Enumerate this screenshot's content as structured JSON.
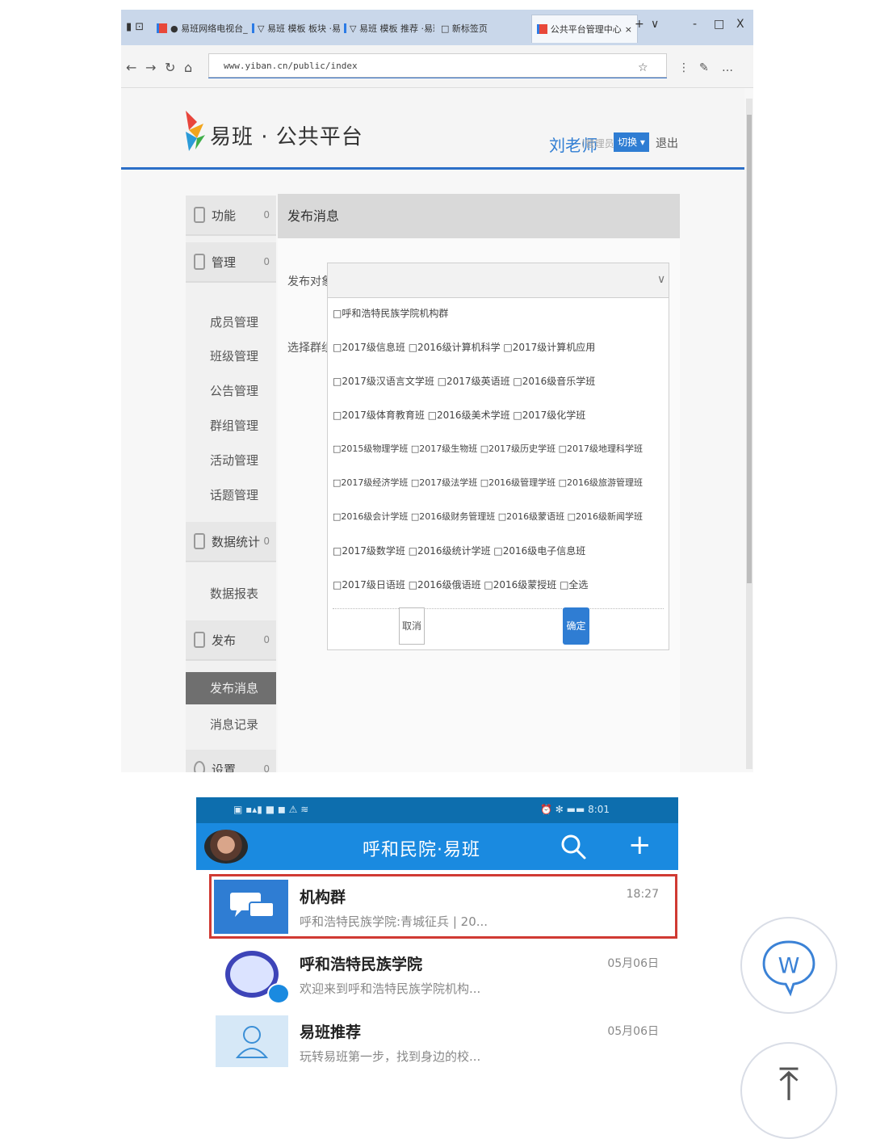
{
  "browser": {
    "tabs": [
      {
        "label": "● 易班网络电视台_"
      },
      {
        "label": "▽ 易班 模板 板块 ·易班"
      },
      {
        "label": "▽ 易班 模板 推荐 ·易班"
      },
      {
        "label": "□ 新标签页"
      },
      {
        "label": "公共平台管理中心"
      }
    ],
    "window_controls": {
      "add": "+",
      "menu": "∨",
      "minimize": "-",
      "restore": "□",
      "close": "X"
    },
    "nav": {
      "back": "←",
      "forward": "→",
      "refresh": "↻",
      "home": "⌂"
    },
    "url": "www.yiban.cn/public/index",
    "toolbar_icons": [
      "☆",
      "⋮",
      "✎",
      "…"
    ]
  },
  "site": {
    "logo_text": "易班 · 公共平台",
    "user_name": "刘老师",
    "user_sub": "(管理员)",
    "switch_button": "切换 ▾",
    "exit": "退出"
  },
  "sidebar": {
    "sections": [
      {
        "label": "功能",
        "count": "0"
      },
      {
        "label": "管理",
        "count": "0"
      }
    ],
    "sub_items": [
      "成员管理",
      "班级管理",
      "公告管理",
      "群组管理",
      "活动管理",
      "话题管理"
    ],
    "sections2": [
      {
        "label": "数据统计",
        "count": "0"
      }
    ],
    "sub_items2": [
      "数据报表"
    ],
    "sections3": [
      {
        "label": "发布",
        "count": "0"
      }
    ],
    "sub_items3": [
      {
        "label": "发布消息",
        "active": true
      },
      {
        "label": "消息记录",
        "active": false
      }
    ],
    "sections4": [
      {
        "label": "设置",
        "count": "0"
      }
    ]
  },
  "panel": {
    "title": "发布消息",
    "target_label": "发布对象:",
    "group_label": "选择群组:",
    "select_arrow": "∨",
    "all_option": "□呼和浩特民族学院机构群",
    "class_rows": [
      "□2017级信息班 □2016级计算机科学 □2017级计算机应用",
      "□2017级汉语言文学班 □2017级英语班 □2016级音乐学班",
      "□2017级体育教育班 □2016级美术学班 □2017级化学班",
      "□2015级物理学班 □2017级生物班 □2017级历史学班 □2017级地理科学班",
      "□2017级经济学班 □2017级法学班 □2016级管理学班 □2016级旅游管理班",
      "□2016级会计学班 □2016级财务管理班 □2016级蒙语班 □2016级新闻学班",
      "□2017级数学班 □2016级统计学班 □2016级电子信息班",
      "□2017级日语班 □2016级俄语班 □2016级蒙授班 □全选"
    ],
    "cancel": "取消",
    "ok": "确定"
  },
  "phone": {
    "status_left": "▣ ▪▴▮ ■ ◼ ⚠ ≋",
    "status_right": "⏰ ✻ ▬▬ 8:01",
    "title": "呼和民院·易班",
    "chats": [
      {
        "title": "机构群",
        "time": "18:27",
        "preview": "呼和浩特民族学院:青城征兵 | 20..."
      },
      {
        "title": "呼和浩特民族学院",
        "time": "05月06日",
        "preview": "欢迎来到呼和浩特民族学院机构..."
      },
      {
        "title": "易班推荐",
        "time": "05月06日",
        "preview": "玩转易班第一步，找到身边的校..."
      }
    ]
  },
  "floating": {
    "app_icon": "W",
    "top_icon": "⤒"
  }
}
